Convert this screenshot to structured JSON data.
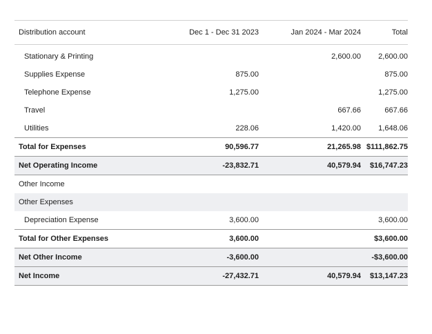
{
  "header": {
    "account": "Distribution account",
    "col1": "Dec 1 - Dec 31 2023",
    "col2": "Jan 2024 - Mar 2024",
    "total": "Total"
  },
  "rows": [
    {
      "label": "Stationary & Printing",
      "col1": "",
      "col2": "2,600.00",
      "total": "2,600.00"
    },
    {
      "label": "Supplies Expense",
      "col1": "875.00",
      "col2": "",
      "total": "875.00"
    },
    {
      "label": "Telephone Expense",
      "col1": "1,275.00",
      "col2": "",
      "total": "1,275.00"
    },
    {
      "label": "Travel",
      "col1": "",
      "col2": "667.66",
      "total": "667.66"
    },
    {
      "label": "Utilities",
      "col1": "228.06",
      "col2": "1,420.00",
      "total": "1,648.06"
    },
    {
      "label": "Total for Expenses",
      "col1": "90,596.77",
      "col2": "21,265.98",
      "total": "$111,862.75"
    },
    {
      "label": "Net Operating Income",
      "col1": "-23,832.71",
      "col2": "40,579.94",
      "total": "$16,747.23"
    },
    {
      "label": "Other Income",
      "col1": "",
      "col2": "",
      "total": ""
    },
    {
      "label": "Other Expenses",
      "col1": "",
      "col2": "",
      "total": ""
    },
    {
      "label": "Depreciation Expense",
      "col1": "3,600.00",
      "col2": "",
      "total": "3,600.00"
    },
    {
      "label": "Total for Other Expenses",
      "col1": "3,600.00",
      "col2": "",
      "total": "$3,600.00"
    },
    {
      "label": "Net Other Income",
      "col1": "-3,600.00",
      "col2": "",
      "total": "-$3,600.00"
    },
    {
      "label": "Net Income",
      "col1": "-27,432.71",
      "col2": "40,579.94",
      "total": "$13,147.23"
    }
  ]
}
